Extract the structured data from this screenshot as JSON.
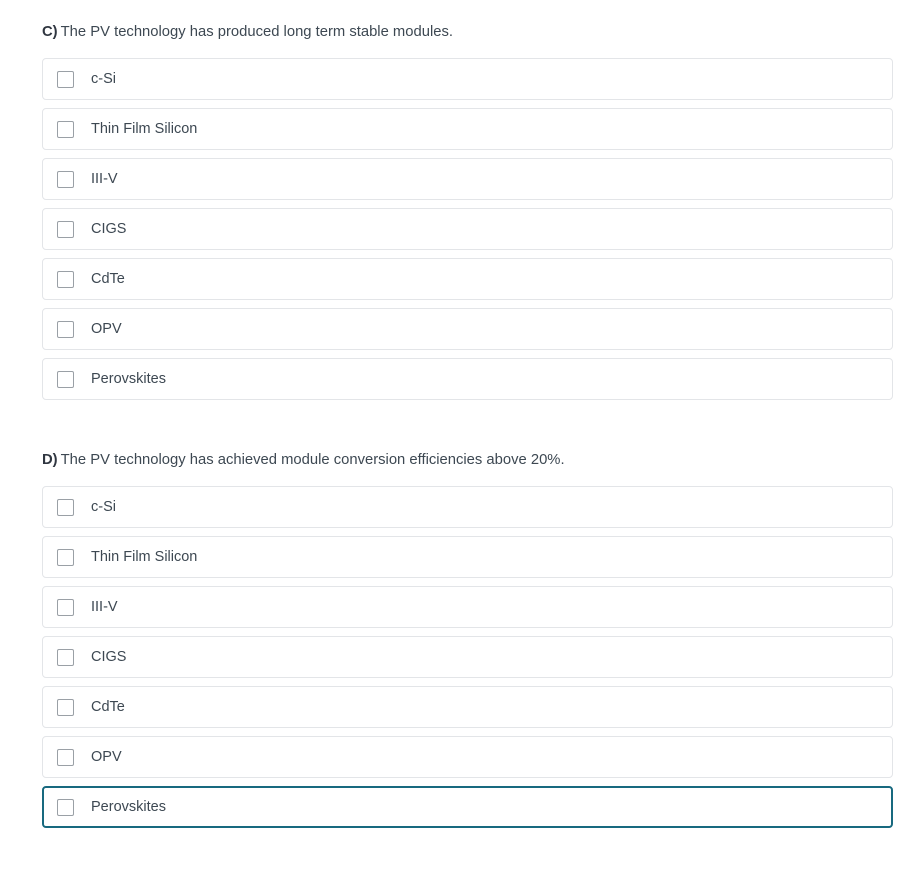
{
  "questions": [
    {
      "letter": "C)",
      "text": "The PV technology has produced long term stable modules.",
      "options": [
        {
          "label": "c-Si",
          "checked": false,
          "focused": false
        },
        {
          "label": "Thin Film Silicon",
          "checked": false,
          "focused": false
        },
        {
          "label": "III-V",
          "checked": false,
          "focused": false
        },
        {
          "label": "CIGS",
          "checked": false,
          "focused": false
        },
        {
          "label": "CdTe",
          "checked": false,
          "focused": false
        },
        {
          "label": "OPV",
          "checked": false,
          "focused": false
        },
        {
          "label": "Perovskites",
          "checked": false,
          "focused": false
        }
      ]
    },
    {
      "letter": "D)",
      "text": "The PV technology has achieved module conversion efficiencies above 20%.",
      "options": [
        {
          "label": "c-Si",
          "checked": false,
          "focused": false
        },
        {
          "label": "Thin Film Silicon",
          "checked": false,
          "focused": false
        },
        {
          "label": "III-V",
          "checked": false,
          "focused": false
        },
        {
          "label": "CIGS",
          "checked": false,
          "focused": false
        },
        {
          "label": "CdTe",
          "checked": false,
          "focused": false
        },
        {
          "label": "OPV",
          "checked": false,
          "focused": false
        },
        {
          "label": "Perovskites",
          "checked": false,
          "focused": true
        }
      ]
    }
  ],
  "colors": {
    "focus_border": "#18697f",
    "row_border": "#e3e5e8",
    "text": "#3d4852",
    "checkbox_border": "#9aa0a6",
    "background": "#ffffff"
  }
}
